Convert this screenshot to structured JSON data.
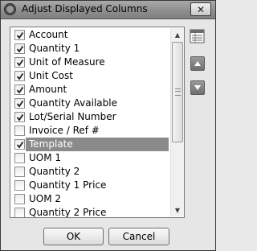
{
  "window": {
    "title": "Adjust Displayed Columns"
  },
  "columns": [
    {
      "label": "Account",
      "checked": true
    },
    {
      "label": "Quantity 1",
      "checked": true
    },
    {
      "label": "Unit of Measure",
      "checked": true
    },
    {
      "label": "Unit Cost",
      "checked": true
    },
    {
      "label": "Amount",
      "checked": true
    },
    {
      "label": "Quantity Available",
      "checked": true
    },
    {
      "label": "Lot/Serial Number",
      "checked": true
    },
    {
      "label": "Invoice / Ref #",
      "checked": false
    },
    {
      "label": "Template",
      "checked": true,
      "selected": true
    },
    {
      "label": "UOM 1",
      "checked": false
    },
    {
      "label": "Quantity 2",
      "checked": false
    },
    {
      "label": "Quantity 1 Price",
      "checked": false
    },
    {
      "label": "UOM 2",
      "checked": false
    },
    {
      "label": "Quantity 2 Price",
      "checked": false
    }
  ],
  "buttons": {
    "ok": "OK",
    "cancel": "Cancel"
  },
  "icons": {
    "title": "app-icon",
    "close": "close-icon",
    "properties": "column-properties-icon",
    "up": "move-up-icon",
    "down": "move-down-icon"
  },
  "colors": {
    "selection": "#8a8a8a",
    "titlebar": "#8f8f8f"
  }
}
